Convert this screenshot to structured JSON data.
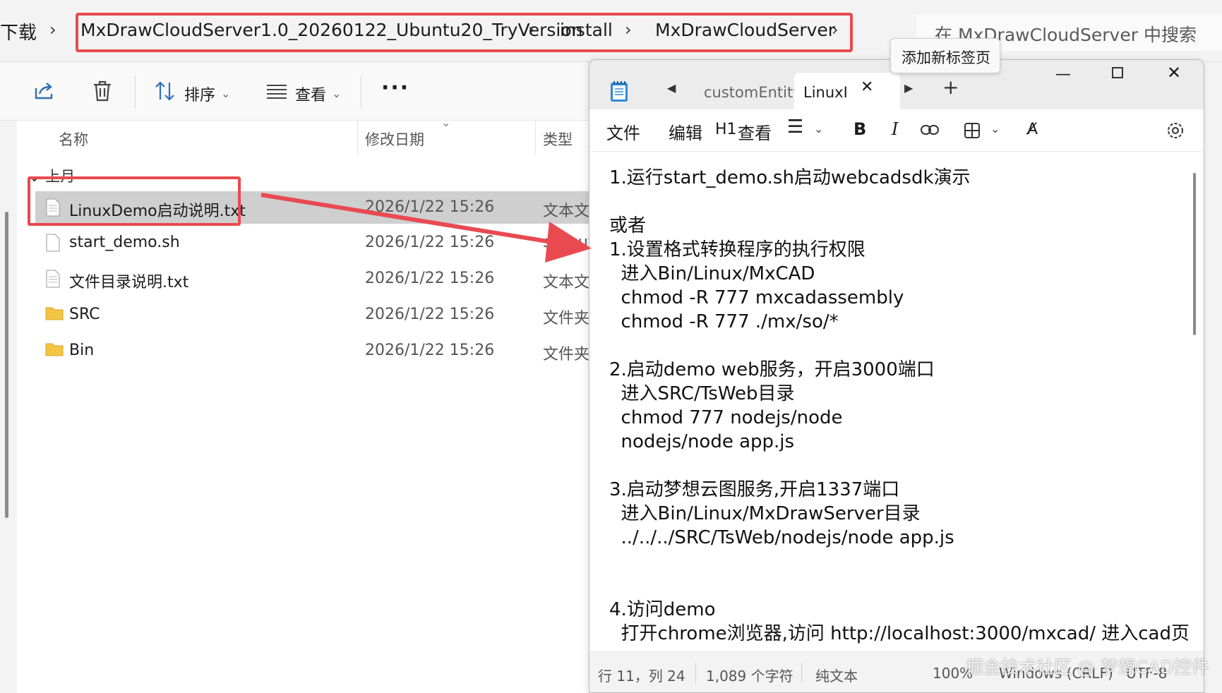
{
  "address_bar": {
    "root_crumb": "下载",
    "crumbs": [
      "MxDrawCloudServer1.0_20260122_Ubuntu20_TryVersion",
      "install",
      "MxDrawCloudServer"
    ],
    "search_placeholder": "在 MxDrawCloudServer 中搜索"
  },
  "tooltip": "添加新标签页",
  "toolbar": {
    "sort_label": "排序",
    "view_label": "查看"
  },
  "columns": {
    "name": "名称",
    "modified": "修改日期",
    "type": "类型"
  },
  "group_header": "上月",
  "files": [
    {
      "name": "LinuxDemo启动说明.txt",
      "date": "2026/1/22 15:26",
      "type": "文本文档",
      "icon": "text-file-icon"
    },
    {
      "name": "start_demo.sh",
      "date": "2026/1/22 15:26",
      "type": "sh_auto_file",
      "icon": "file-icon"
    },
    {
      "name": "文件目录说明.txt",
      "date": "2026/1/22 15:26",
      "type": "文本文档",
      "icon": "text-file-icon"
    },
    {
      "name": "SRC",
      "date": "2026/1/22 15:26",
      "type": "文件夹",
      "icon": "folder-icon"
    },
    {
      "name": "Bin",
      "date": "2026/1/22 15:26",
      "type": "文件夹",
      "icon": "folder-icon"
    }
  ],
  "notepad": {
    "tabs": [
      "customEntity",
      "LinuxI"
    ],
    "menu": {
      "file": "文件",
      "edit": "编辑",
      "view": "查看",
      "heading": "H1"
    },
    "content_lines": [
      "1.运行start_demo.sh启动webcadsdk演示",
      "",
      "或者",
      "1.设置格式转换程序的执行权限",
      "  进入Bin/Linux/MxCAD",
      "  chmod -R 777 mxcadassembly",
      "  chmod -R 777 ./mx/so/*",
      "",
      "2.启动demo web服务，开启3000端口",
      "  进入SRC/TsWeb目录",
      "  chmod 777 nodejs/node",
      "  nodejs/node app.js",
      "",
      "3.启动梦想云图服务,开启1337端口",
      "  进入Bin/Linux/MxDrawServer目录",
      "  ../../../SRC/TsWeb/nodejs/node app.js",
      "",
      "",
      "4.访问demo",
      "  打开chrome浏览器,访问 http://localhost:3000/mxcad/ 进入cad页"
    ],
    "status": {
      "position": "行 11，列 24",
      "chars": "1,089 个字符",
      "format": "纯文本",
      "zoom": "100%",
      "line_ending": "Windows (CRLF)",
      "encoding": "UTF-8"
    }
  },
  "watermark": "掘金技术社区 @ 梦想CAD控件",
  "colors": {
    "highlight": "#e84a50",
    "selected_row": "#cfcfcf"
  }
}
